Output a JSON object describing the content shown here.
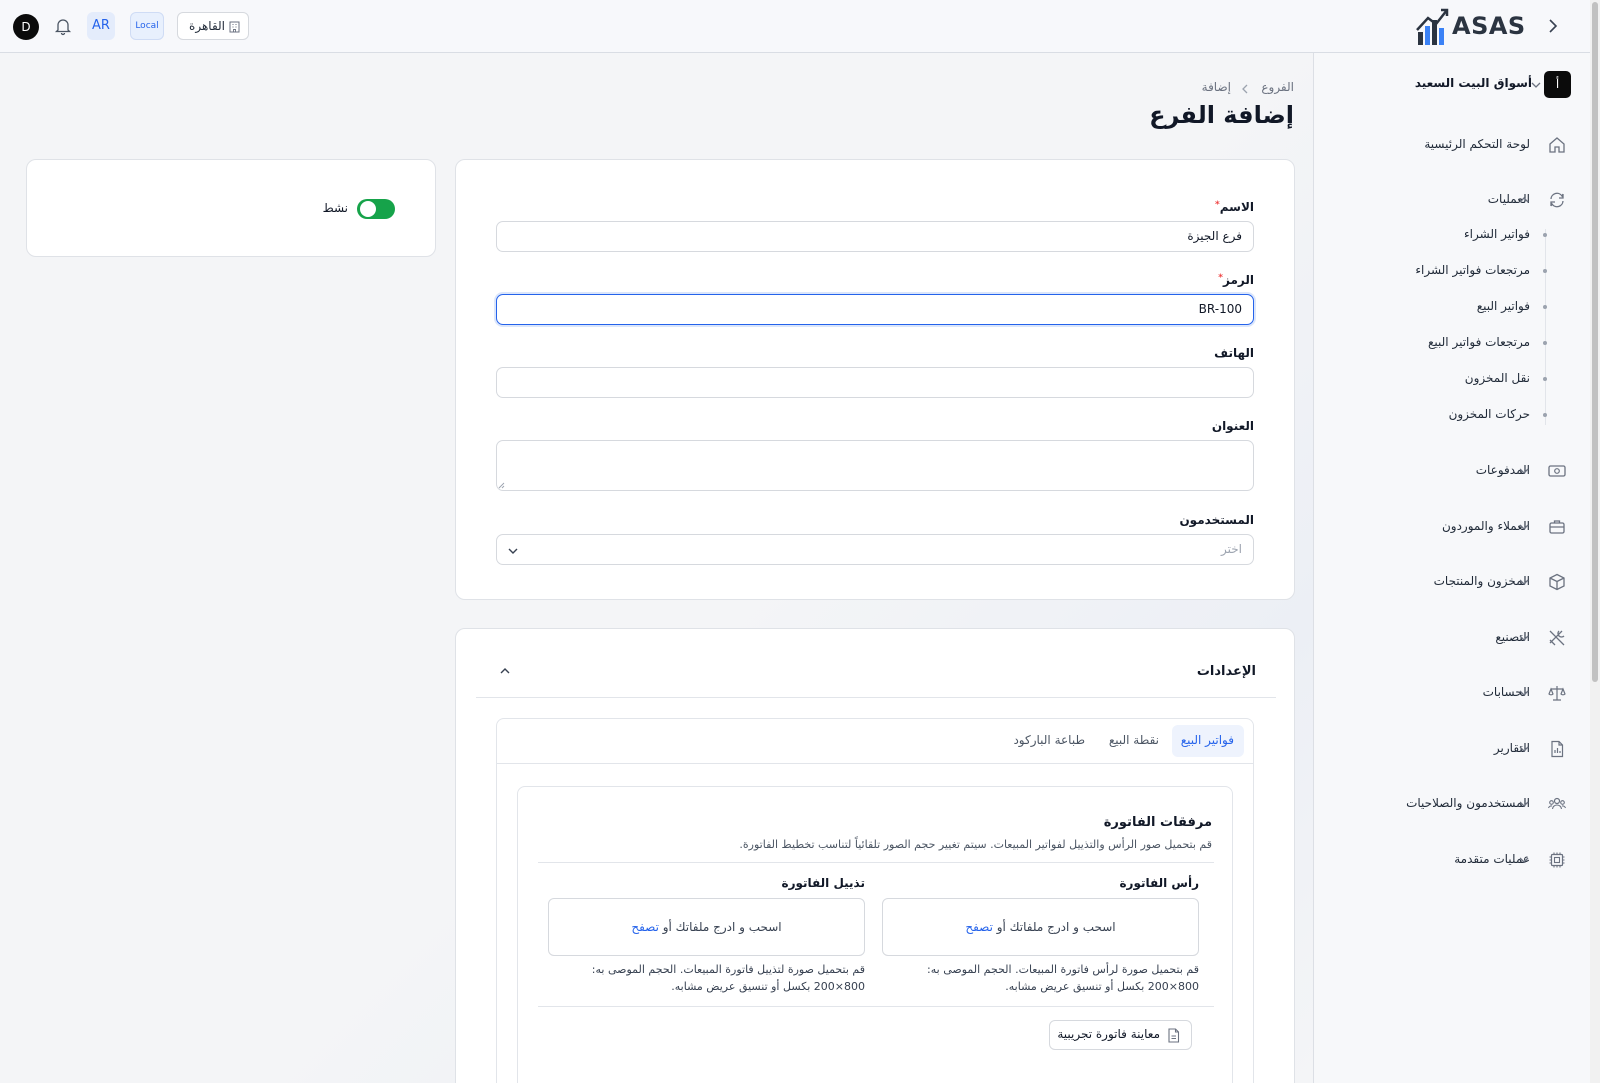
{
  "topbar": {
    "logo_text": "ASAS",
    "branch_label": "القاهرة",
    "env_badge": "Local",
    "lang_badge": "AR",
    "avatar_initial": "D"
  },
  "sidebar": {
    "company": {
      "initial": "أ",
      "name": "أسواق البيت السعيد"
    },
    "dashboard": "لوحة التحكم الرئيسية",
    "operations": {
      "label": "العمليات",
      "children": [
        "فواتير الشراء",
        "مرتجعات فواتير الشراء",
        "فواتير البيع",
        "مرتجعات فواتير البيع",
        "نقل المخزون",
        "حركات المخزون"
      ]
    },
    "groups": [
      {
        "label": "المدفوعات",
        "icon": "money-icon"
      },
      {
        "label": "العملاء والموردون",
        "icon": "briefcase-icon"
      },
      {
        "label": "المخزون والمنتجات",
        "icon": "box-icon"
      },
      {
        "label": "التصنيع",
        "icon": "tools-icon"
      },
      {
        "label": "الحسابات",
        "icon": "scale-icon"
      },
      {
        "label": "التقارير",
        "icon": "report-icon"
      },
      {
        "label": "المستخدمون والصلاحيات",
        "icon": "users-icon"
      },
      {
        "label": "عمليات متقدمة",
        "icon": "chip-icon"
      }
    ]
  },
  "breadcrumb": {
    "parent": "الفروع",
    "current": "إضافة"
  },
  "page_title": "إضافة الفرع",
  "form": {
    "name": {
      "label": "الاسم",
      "required": "*",
      "value": "فرع الجيزة"
    },
    "code": {
      "label": "الرمز",
      "required": "*",
      "value": "BR-100"
    },
    "phone": {
      "label": "الهاتف",
      "value": ""
    },
    "address": {
      "label": "العنوان",
      "value": ""
    },
    "users": {
      "label": "المستخدمون",
      "placeholder": "اختر"
    }
  },
  "status": {
    "label": "نشط",
    "active": true
  },
  "settings": {
    "title": "الإعدادات",
    "tabs": [
      "فواتير البيع",
      "نقطة البيع",
      "طباعة الباركود"
    ],
    "active_tab": 0,
    "attachments": {
      "title": "مرفقات الفاتورة",
      "description": "قم بتحميل صور الرأس والتذييل لفواتير المبيعات. سيتم تغيير حجم الصور تلقائياً لتناسب تخطيط الفاتورة.",
      "header": {
        "label": "رأس الفاتورة",
        "drop_text": "اسحب و ادرج ملفاتك أو",
        "browse": "تصفح",
        "help_line1": "قم بتحميل صورة لرأس فاتورة المبيعات. الحجم الموصى به:",
        "help_line2": "800×200 بكسل أو تنسيق عريض مشابه."
      },
      "footer": {
        "label": "تذييل الفاتورة",
        "drop_text": "اسحب و ادرج ملفاتك أو",
        "browse": "تصفح",
        "help_line1": "قم بتحميل صورة لتذييل فاتورة المبيعات. الحجم الموصى به:",
        "help_line2": "800×200 بكسل أو تنسيق عريض مشابه."
      },
      "preview_button": "معاينة فاتورة تجريبية"
    }
  },
  "colors": {
    "primary": "#2563eb",
    "toggle_on": "#16a34a",
    "required": "#ef4444",
    "logo_dark": "#2b3441",
    "logo_accent": "#3b82f6"
  }
}
